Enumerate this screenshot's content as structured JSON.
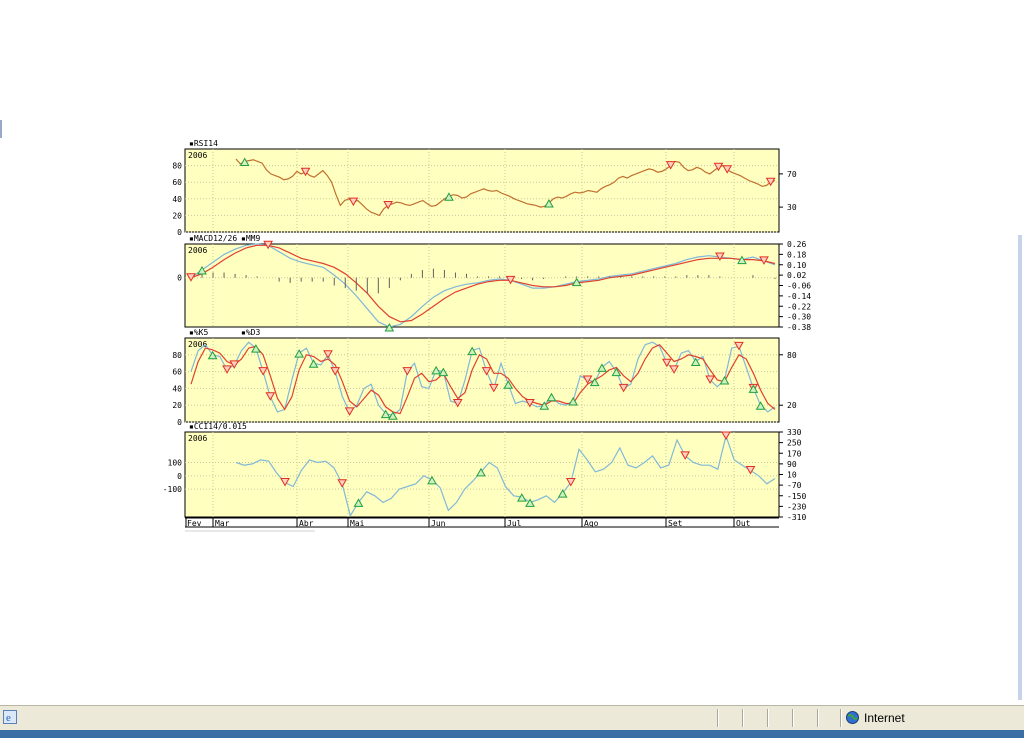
{
  "months": [
    "Fev",
    "Mar",
    "Abr",
    "Mai",
    "Jun",
    "Jul",
    "Ago",
    "Set",
    "Out"
  ],
  "status": {
    "zone_label": "Internet"
  },
  "colors": {
    "panel_bg": "#ffffc0",
    "price_line": "#c07030",
    "signal_line": "#e04030",
    "indicator_line": "#80b8d8",
    "sell_marker": "#e03020",
    "buy_marker": "#20a040",
    "grid": "#c8c8a0"
  },
  "chart_data": [
    {
      "type": "line",
      "title": "RSI14",
      "watermark": "2006",
      "y_left_ticks": [
        "80",
        "60",
        "40",
        "20",
        "0"
      ],
      "y_right_ticks": [
        "70",
        "30"
      ],
      "ylim": [
        0,
        100
      ],
      "series": [
        {
          "name": "RSI14",
          "values": [
            88,
            82,
            85,
            86,
            87,
            85,
            83,
            75,
            70,
            68,
            66,
            63,
            64,
            67,
            73,
            70,
            72,
            68,
            66,
            70,
            74,
            68,
            60,
            45,
            32,
            38,
            40,
            36,
            38,
            33,
            28,
            24,
            22,
            20,
            28,
            32,
            34,
            36,
            35,
            33,
            32,
            34,
            36,
            38,
            34,
            31,
            32,
            36,
            40,
            43,
            45,
            44,
            41,
            42,
            46,
            48,
            50,
            52,
            50,
            49,
            50,
            47,
            45,
            43,
            40,
            38,
            36,
            34,
            33,
            32,
            30,
            31,
            35,
            40,
            42,
            41,
            43,
            46,
            48,
            47,
            48,
            50,
            49,
            48,
            52,
            55,
            57,
            60,
            65,
            67,
            65,
            68,
            70,
            72,
            74,
            76,
            75,
            72,
            73,
            76,
            80,
            85,
            84,
            78,
            74,
            75,
            78,
            76,
            72,
            70,
            74,
            78,
            80,
            75,
            72,
            70,
            68,
            65,
            62,
            60,
            58,
            55,
            56,
            60,
            62
          ]
        }
      ],
      "sell_signals_index": [
        16,
        27,
        35,
        100,
        111,
        113,
        123,
        125
      ],
      "buy_signals_index": [
        2,
        49,
        72
      ]
    },
    {
      "type": "line",
      "title": "MACD12/26",
      "legend": [
        "MACD12/26",
        "MM9"
      ],
      "watermark": "2006",
      "y_left_ticks": [
        "0"
      ],
      "y_right_ticks": [
        "0.26",
        "0.18",
        "0.10",
        "0.02",
        "-0.06",
        "-0.14",
        "-0.22",
        "-0.30",
        "-0.38"
      ],
      "ylim": [
        -0.38,
        0.26
      ],
      "series": [
        {
          "name": "MACD12/26",
          "values": [
            0.0,
            0.06,
            0.12,
            0.18,
            0.22,
            0.25,
            0.26,
            0.25,
            0.2,
            0.15,
            0.12,
            0.1,
            0.08,
            0.02,
            -0.05,
            -0.14,
            -0.24,
            -0.34,
            -0.38,
            -0.36,
            -0.3,
            -0.22,
            -0.15,
            -0.1,
            -0.07,
            -0.05,
            -0.04,
            -0.02,
            -0.01,
            -0.02,
            -0.05,
            -0.08,
            -0.08,
            -0.07,
            -0.05,
            -0.03,
            -0.02,
            -0.01,
            0.01,
            0.02,
            0.03,
            0.05,
            0.07,
            0.09,
            0.11,
            0.14,
            0.16,
            0.17,
            0.16,
            0.15,
            0.14,
            0.16,
            0.13,
            0.1
          ]
        },
        {
          "name": "MM9",
          "values": [
            0.0,
            0.03,
            0.08,
            0.14,
            0.19,
            0.23,
            0.25,
            0.25,
            0.23,
            0.19,
            0.15,
            0.13,
            0.11,
            0.08,
            0.03,
            -0.04,
            -0.12,
            -0.22,
            -0.3,
            -0.34,
            -0.33,
            -0.28,
            -0.22,
            -0.16,
            -0.11,
            -0.08,
            -0.05,
            -0.03,
            -0.02,
            -0.02,
            -0.04,
            -0.06,
            -0.07,
            -0.07,
            -0.06,
            -0.04,
            -0.03,
            -0.02,
            0.0,
            0.01,
            0.02,
            0.04,
            0.06,
            0.08,
            0.1,
            0.12,
            0.14,
            0.15,
            0.15,
            0.15,
            0.14,
            0.14,
            0.13,
            0.11
          ]
        },
        {
          "name": "histogram",
          "values": [
            0.0,
            0.03,
            0.04,
            0.04,
            0.03,
            0.02,
            0.01,
            0.0,
            -0.03,
            -0.04,
            -0.03,
            -0.03,
            -0.03,
            -0.06,
            -0.08,
            -0.1,
            -0.12,
            -0.12,
            -0.08,
            -0.02,
            0.03,
            0.06,
            0.07,
            0.06,
            0.04,
            0.03,
            0.01,
            0.01,
            0.01,
            0.0,
            -0.01,
            -0.02,
            -0.01,
            0.0,
            0.01,
            0.01,
            0.01,
            0.01,
            0.01,
            0.01,
            0.01,
            0.01,
            0.01,
            0.01,
            0.01,
            0.02,
            0.02,
            0.02,
            0.01,
            0.0,
            0.0,
            0.02,
            0.0,
            -0.01
          ]
        }
      ],
      "sell_signals_index": [
        0,
        7,
        29,
        48,
        52
      ],
      "buy_signals_index": [
        1,
        18,
        35,
        50
      ]
    },
    {
      "type": "line",
      "title": "%K5",
      "legend": [
        "%K5",
        "%D3"
      ],
      "watermark": "2006",
      "y_left_ticks": [
        "80",
        "60",
        "40",
        "20",
        "0"
      ],
      "y_right_ticks": [
        "80",
        "20"
      ],
      "ylim": [
        0,
        100
      ],
      "series": [
        {
          "name": "%K5",
          "values": [
            60,
            85,
            92,
            80,
            78,
            62,
            68,
            85,
            95,
            88,
            60,
            30,
            12,
            15,
            50,
            82,
            88,
            70,
            68,
            80,
            60,
            30,
            12,
            20,
            40,
            45,
            20,
            10,
            8,
            15,
            60,
            70,
            42,
            40,
            62,
            60,
            25,
            22,
            50,
            85,
            88,
            60,
            40,
            70,
            45,
            22,
            25,
            22,
            18,
            20,
            30,
            22,
            20,
            25,
            55,
            50,
            48,
            65,
            72,
            60,
            40,
            45,
            75,
            92,
            95,
            90,
            70,
            62,
            82,
            85,
            72,
            78,
            50,
            42,
            50,
            88,
            90,
            65,
            40,
            20,
            12,
            18
          ]
        },
        {
          "name": "%D3",
          "values": [
            45,
            72,
            88,
            86,
            82,
            72,
            68,
            75,
            88,
            90,
            80,
            55,
            28,
            15,
            30,
            62,
            80,
            78,
            72,
            75,
            68,
            48,
            25,
            18,
            28,
            38,
            32,
            18,
            12,
            10,
            30,
            52,
            58,
            48,
            50,
            58,
            42,
            28,
            35,
            62,
            80,
            75,
            58,
            58,
            52,
            40,
            30,
            25,
            22,
            20,
            25,
            25,
            22,
            22,
            35,
            45,
            50,
            55,
            62,
            65,
            55,
            48,
            58,
            75,
            88,
            92,
            82,
            72,
            75,
            80,
            78,
            75,
            62,
            50,
            48,
            65,
            80,
            75,
            58,
            38,
            22,
            15
          ]
        }
      ],
      "sell_signals_index": [
        5,
        6,
        10,
        11,
        19,
        20,
        22,
        30,
        37,
        41,
        42,
        47,
        55,
        60,
        66,
        67,
        72,
        76,
        78,
        83,
        84
      ],
      "buy_signals_index": [
        3,
        9,
        15,
        17,
        27,
        28,
        34,
        35,
        39,
        44,
        49,
        50,
        53,
        56,
        57,
        59,
        70,
        74,
        78,
        79,
        86
      ]
    },
    {
      "type": "line",
      "title": "CCI14/0.015",
      "watermark": "2006",
      "y_left_ticks": [
        "100",
        "0",
        "-100"
      ],
      "y_right_ticks": [
        "330",
        "250",
        "170",
        "90",
        "10",
        "-70",
        "-150",
        "-230",
        "-310"
      ],
      "ylim": [
        -310,
        330
      ],
      "series": [
        {
          "name": "CCI14/0.015",
          "values": [
            100,
            80,
            90,
            120,
            110,
            20,
            -50,
            -80,
            40,
            120,
            100,
            110,
            60,
            -60,
            -300,
            -200,
            -120,
            -150,
            -200,
            -170,
            -100,
            -80,
            -60,
            0,
            -30,
            -90,
            -260,
            -200,
            -100,
            -40,
            30,
            100,
            60,
            -80,
            -150,
            -160,
            -200,
            -180,
            -150,
            -200,
            -130,
            -50,
            200,
            120,
            30,
            50,
            100,
            210,
            80,
            60,
            100,
            150,
            60,
            80,
            270,
            150,
            100,
            80,
            80,
            50,
            300,
            120,
            80,
            40,
            0,
            -60,
            -20
          ]
        }
      ],
      "sell_signals_index": [
        6,
        13,
        41,
        55,
        60,
        63,
        71,
        78
      ],
      "buy_signals_index": [
        15,
        24,
        30,
        35,
        36,
        40
      ]
    }
  ]
}
